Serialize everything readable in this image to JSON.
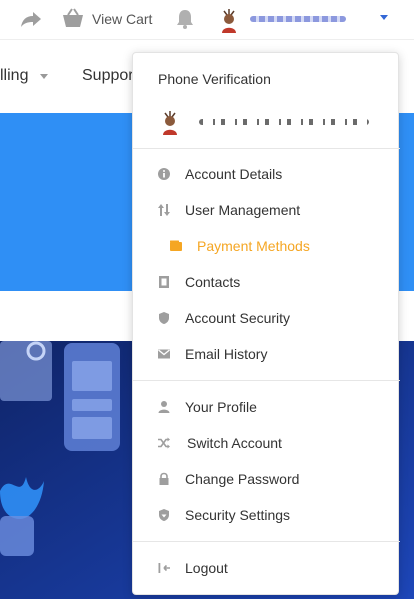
{
  "topbar": {
    "cart_label": "View Cart",
    "icons": [
      "share-icon",
      "basket-icon",
      "bell-icon",
      "avatar",
      "chevron-down-icon"
    ]
  },
  "nav": {
    "billing_label": "lling",
    "support_label": "Suppor"
  },
  "dropdown": {
    "title": "Phone Verification",
    "sections": [
      {
        "items": [
          {
            "label": "Account Details",
            "icon": "info-icon"
          },
          {
            "label": "User Management",
            "icon": "sort-icon"
          },
          {
            "label": "Payment Methods",
            "icon": "wallet-icon",
            "active": true
          },
          {
            "label": "Contacts",
            "icon": "contact-book-icon"
          },
          {
            "label": "Account Security",
            "icon": "shield-icon"
          },
          {
            "label": "Email History",
            "icon": "envelope-icon"
          }
        ]
      },
      {
        "items": [
          {
            "label": "Your Profile",
            "icon": "user-icon"
          },
          {
            "label": "Switch Account",
            "icon": "shuffle-icon"
          },
          {
            "label": "Change Password",
            "icon": "lock-icon"
          },
          {
            "label": "Security Settings",
            "icon": "shield-check-icon"
          }
        ]
      },
      {
        "items": [
          {
            "label": "Logout",
            "icon": "logout-icon"
          }
        ]
      }
    ]
  },
  "colors": {
    "accent_blue": "#2f8ff5",
    "active_orange": "#f5a623",
    "icon_gray": "#9e9e9e",
    "hero_navy": "#122b7a"
  }
}
